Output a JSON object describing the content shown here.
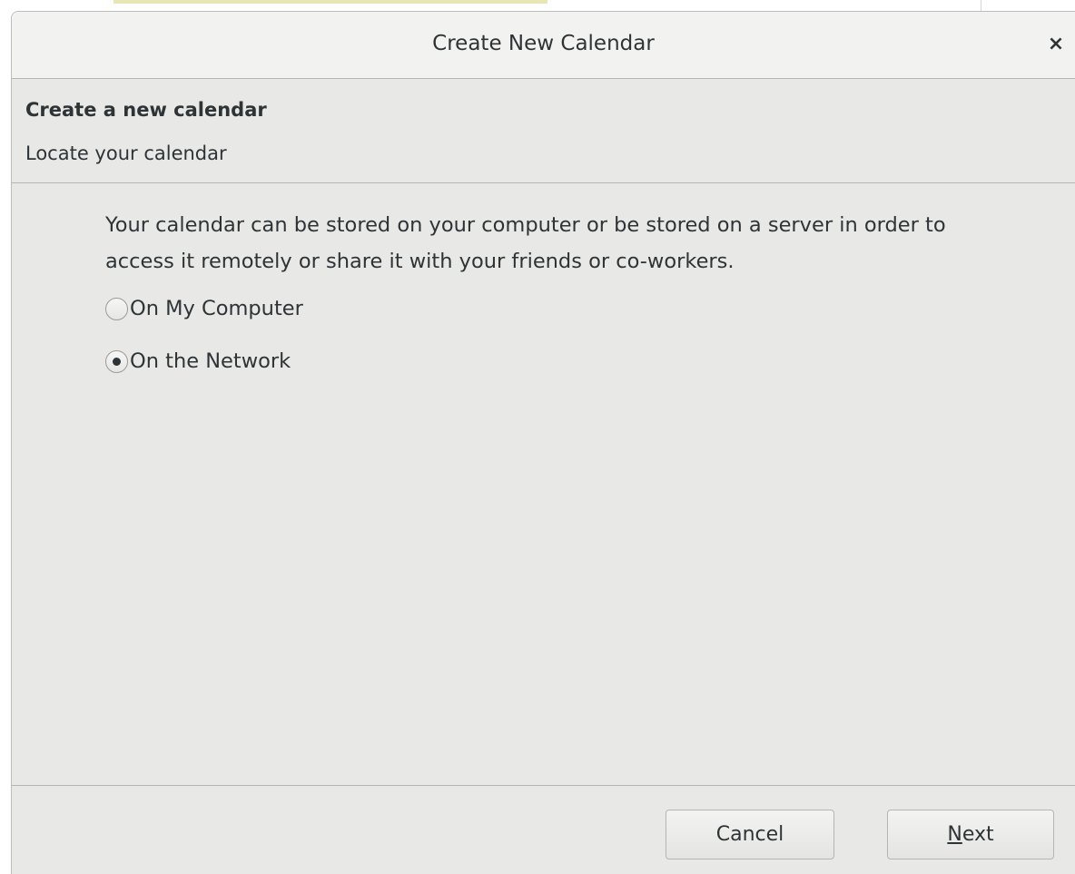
{
  "dialog": {
    "title": "Create New Calendar",
    "close_icon": "close-icon",
    "close_glyph": "×"
  },
  "header": {
    "title": "Create a new calendar",
    "subtitle": "Locate your calendar"
  },
  "content": {
    "description": "Your calendar can be stored on your computer or be stored on a server in order to access it remotely or share it with your friends or co-workers.",
    "options": [
      {
        "label": "On My Computer",
        "selected": false
      },
      {
        "label": "On the Network",
        "selected": true
      }
    ]
  },
  "footer": {
    "cancel_label": "Cancel",
    "next_mnemonic": "N",
    "next_rest": "ext"
  }
}
